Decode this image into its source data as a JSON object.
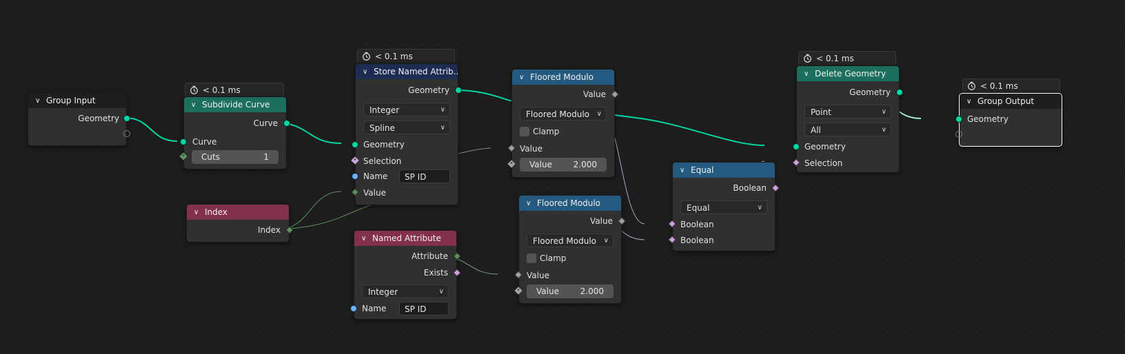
{
  "colors": {
    "geometry_socket": "#00d6a3",
    "string_socket": "#70b2ff",
    "boolean_socket": "#cca6d6",
    "integer_socket": "#5d9160",
    "float_socket": "#a1a1a1",
    "header_geometry": "#1b6f5c",
    "header_attribute": "#1e2b52",
    "header_math": "#245a7f",
    "header_input": "#83314a"
  },
  "nodes": {
    "group_input": {
      "title": "Group Input",
      "outputs": [
        "Geometry"
      ]
    },
    "subdivide_curve": {
      "timer": "< 0.1 ms",
      "title": "Subdivide Curve",
      "outputs": [
        "Curve"
      ],
      "inputs": [
        "Curve"
      ],
      "cuts_label": "Cuts",
      "cuts_value": "1"
    },
    "store_named_attribute": {
      "timer": "< 0.1 ms",
      "title": "Store Named Attrib...",
      "outputs": [
        "Geometry"
      ],
      "data_type": "Integer",
      "domain": "Spline",
      "inputs": [
        "Geometry",
        "Selection",
        "Name",
        "Value"
      ],
      "name_value": "SP ID"
    },
    "index": {
      "title": "Index",
      "outputs": [
        "Index"
      ]
    },
    "named_attribute": {
      "title": "Named Attribute",
      "outputs": [
        "Attribute",
        "Exists"
      ],
      "data_type": "Integer",
      "name_label": "Name",
      "name_value": "SP ID"
    },
    "floored_modulo_1": {
      "title": "Floored Modulo",
      "outputs": [
        "Value"
      ],
      "operation": "Floored Modulo",
      "clamp_label": "Clamp",
      "inputs": [
        "Value"
      ],
      "value_label": "Value",
      "value_value": "2.000"
    },
    "floored_modulo_2": {
      "title": "Floored Modulo",
      "outputs": [
        "Value"
      ],
      "operation": "Floored Modulo",
      "clamp_label": "Clamp",
      "inputs": [
        "Value"
      ],
      "value_label": "Value",
      "value_value": "2.000"
    },
    "equal": {
      "title": "Equal",
      "outputs": [
        "Boolean"
      ],
      "operation": "Equal",
      "inputs": [
        "Boolean",
        "Boolean"
      ]
    },
    "delete_geometry": {
      "timer": "< 0.1 ms",
      "title": "Delete Geometry",
      "outputs": [
        "Geometry"
      ],
      "domain": "Point",
      "mode": "All",
      "inputs": [
        "Geometry",
        "Selection"
      ]
    },
    "group_output": {
      "timer": "< 0.1 ms",
      "title": "Group Output",
      "inputs": [
        "Geometry"
      ]
    }
  }
}
